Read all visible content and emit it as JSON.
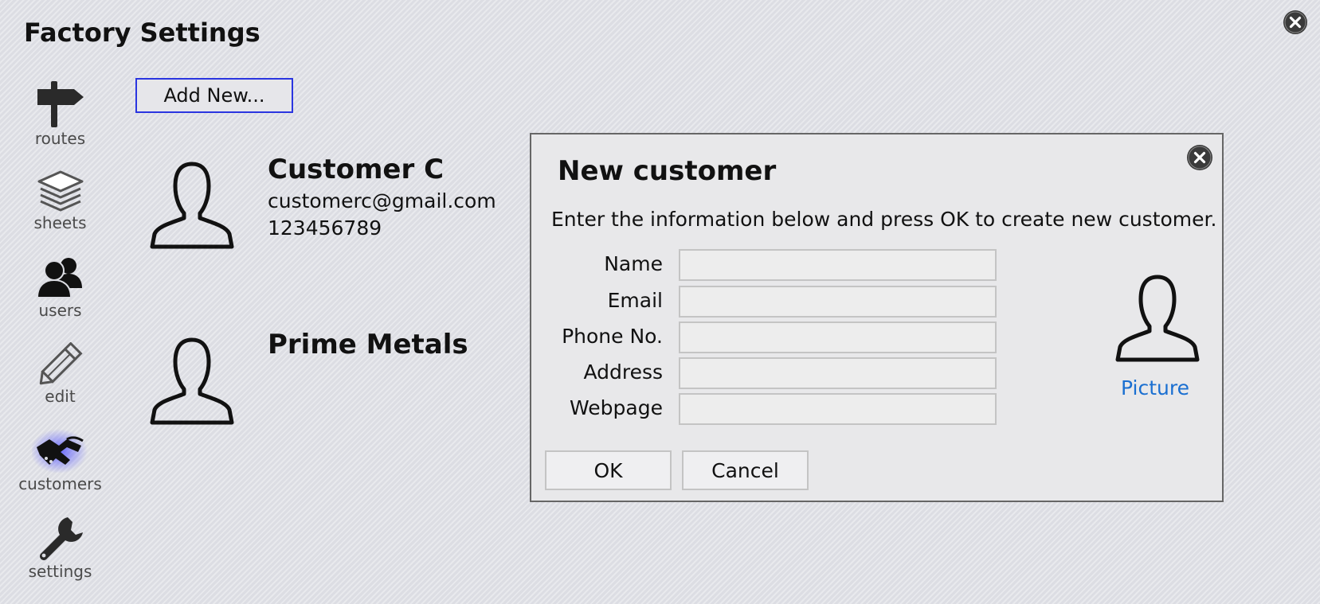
{
  "app": {
    "title": "Factory Settings"
  },
  "window": {
    "close_icon": "close-circle-icon"
  },
  "sidebar": {
    "items": [
      {
        "label": "routes",
        "icon": "signpost-icon"
      },
      {
        "label": "sheets",
        "icon": "stack-icon"
      },
      {
        "label": "users",
        "icon": "users-icon"
      },
      {
        "label": "edit",
        "icon": "pencil-icon"
      },
      {
        "label": "customers",
        "icon": "handshake-icon",
        "active": true
      },
      {
        "label": "settings",
        "icon": "wrench-icon"
      }
    ],
    "active_glow_color": "#5b5bff"
  },
  "toolbar": {
    "add_new_label": "Add New...",
    "accent": "#2a35e0"
  },
  "customers": [
    {
      "name": "Customer C",
      "email": "customerc@gmail.com",
      "phone": "123456789",
      "avatar": "person-silhouette-icon"
    },
    {
      "name": "Prime Metals",
      "email": "",
      "phone": "",
      "avatar": "person-silhouette-icon"
    }
  ],
  "dialog": {
    "title": "New customer",
    "description": "Enter the information below and press OK to create new customer.",
    "fields": [
      {
        "label": "Name",
        "value": ""
      },
      {
        "label": "Email",
        "value": ""
      },
      {
        "label": "Phone No.",
        "value": ""
      },
      {
        "label": "Address",
        "value": ""
      },
      {
        "label": "Webpage",
        "value": ""
      }
    ],
    "picture_label": "Picture",
    "ok_label": "OK",
    "cancel_label": "Cancel",
    "link_color": "#1a6fd1"
  }
}
